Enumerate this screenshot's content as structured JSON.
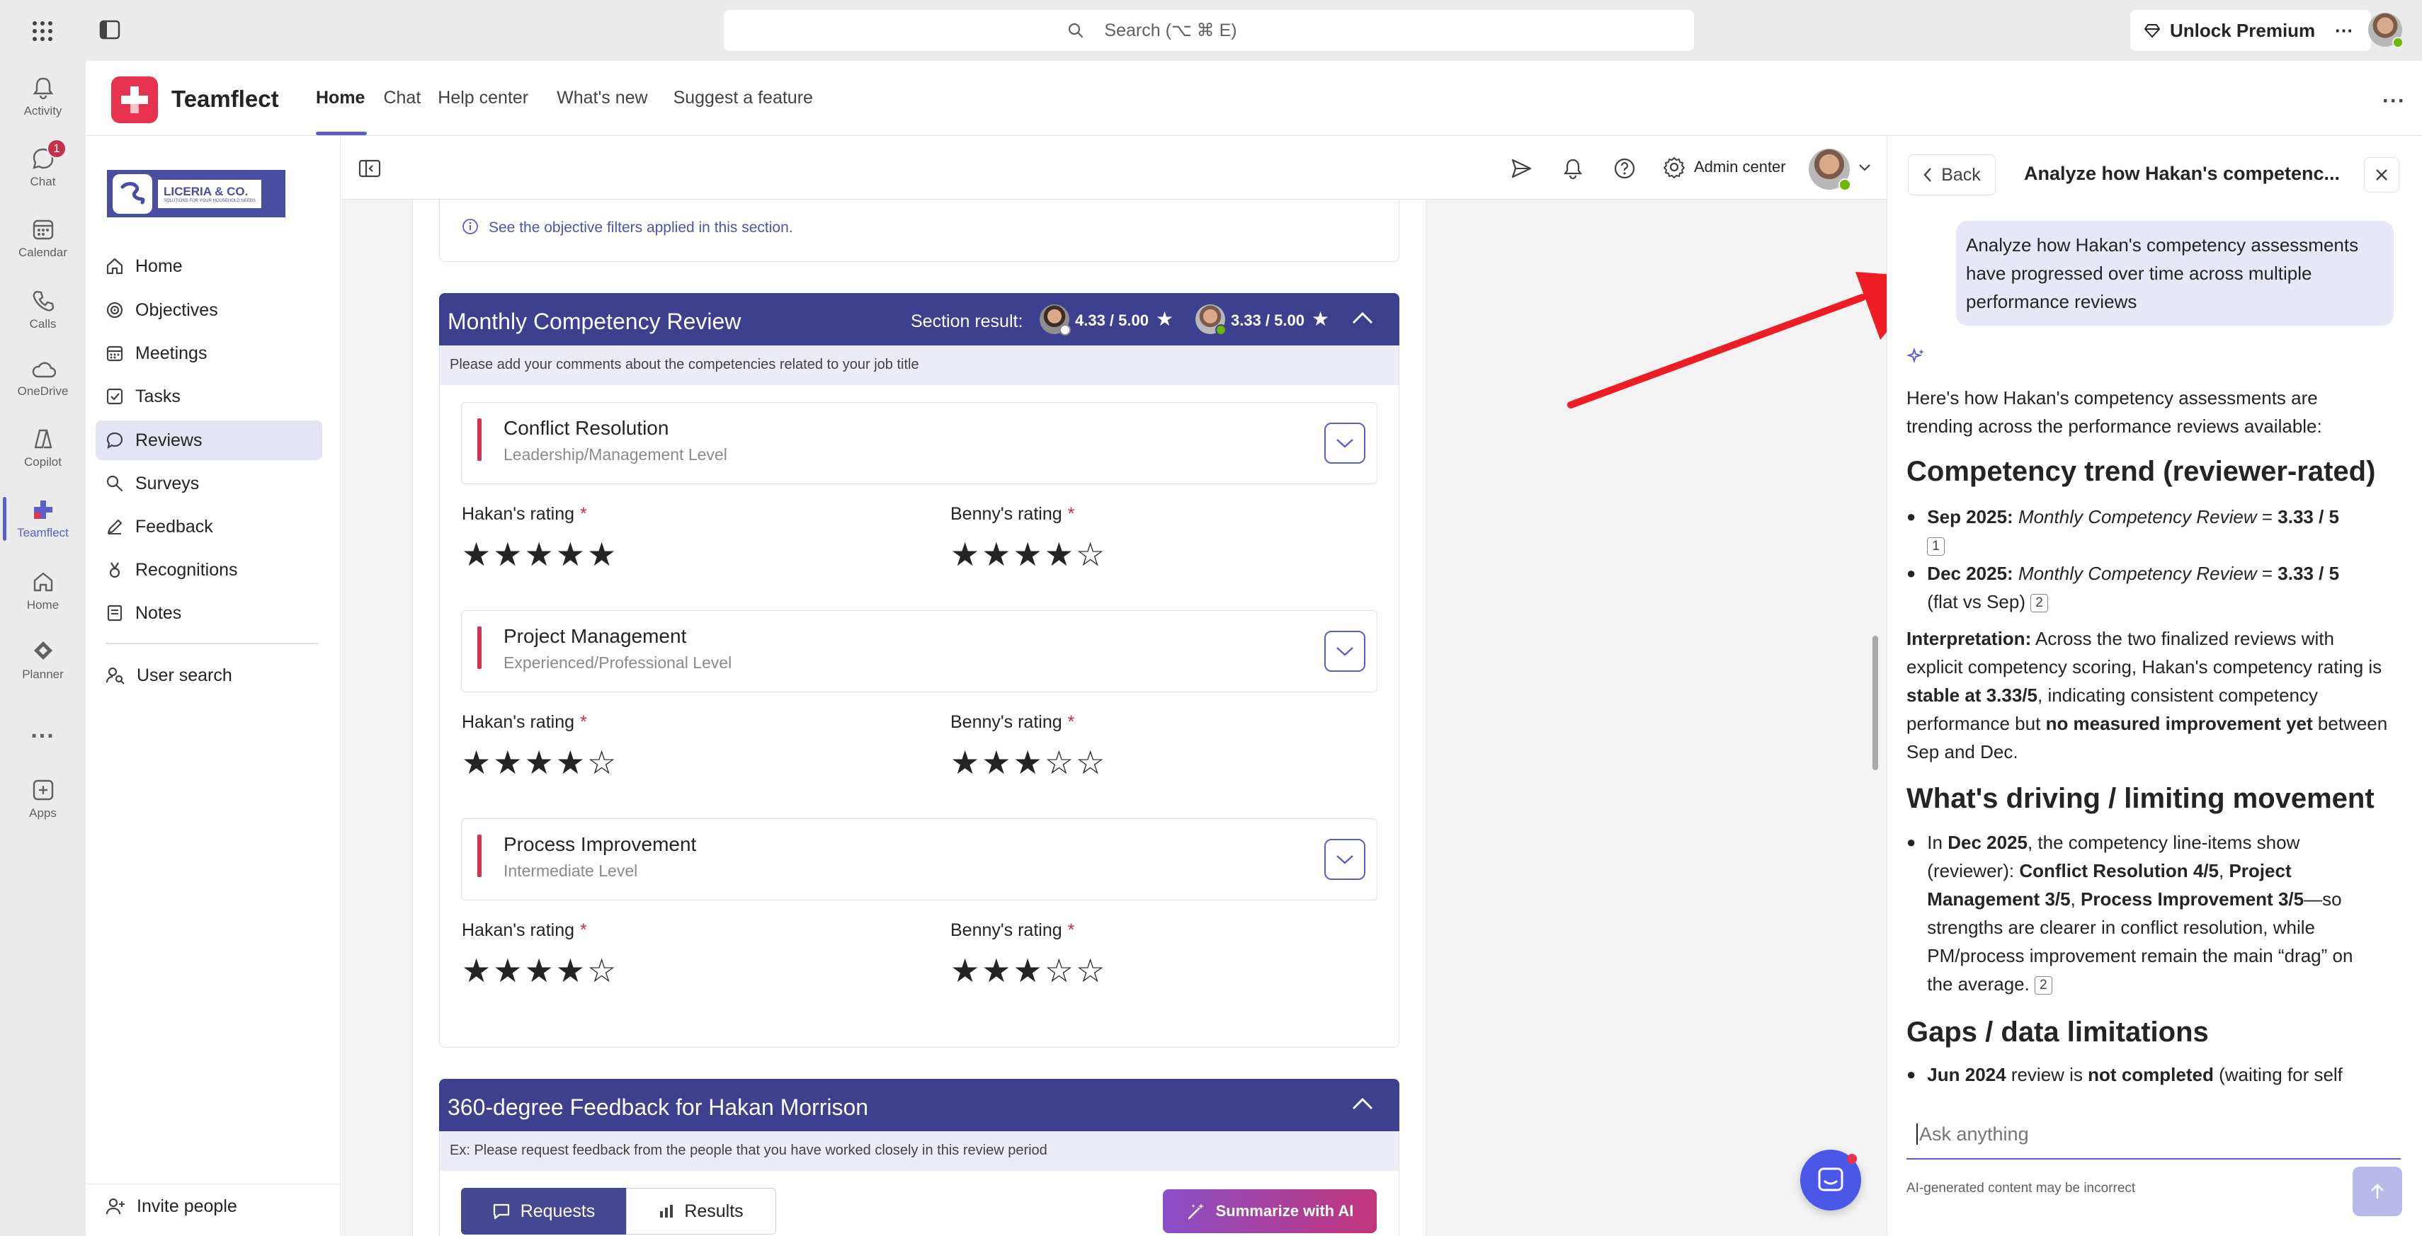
{
  "topbar": {
    "search_placeholder": "Search (⌥ ⌘ E)",
    "unlock_label": "Unlock Premium",
    "more_label": "···"
  },
  "rail": {
    "items": [
      {
        "label": "Activity",
        "icon": "bell-icon"
      },
      {
        "label": "Chat",
        "icon": "chat-icon",
        "badge": "1"
      },
      {
        "label": "Calendar",
        "icon": "calendar-icon"
      },
      {
        "label": "Calls",
        "icon": "phone-icon"
      },
      {
        "label": "OneDrive",
        "icon": "cloud-icon"
      },
      {
        "label": "Copilot",
        "icon": "copilot-icon"
      },
      {
        "label": "Teamflect",
        "icon": "teamflect-icon"
      },
      {
        "label": "Home",
        "icon": "home-icon"
      },
      {
        "label": "Planner",
        "icon": "planner-icon"
      },
      {
        "label": "...",
        "icon": "more-icon"
      },
      {
        "label": "Apps",
        "icon": "apps-icon"
      }
    ]
  },
  "app": {
    "name": "Teamflect",
    "tabs": [
      "Home",
      "Chat",
      "Help center",
      "What's new",
      "Suggest a feature"
    ],
    "active_tab": "Home"
  },
  "logo": {
    "brand": "LICERIA & CO.",
    "tagline": "SOLUTIONS FOR YOUR HOUSEHOLD NEEDS"
  },
  "sidebar": {
    "items": [
      {
        "label": "Home",
        "icon": "home-icon"
      },
      {
        "label": "Objectives",
        "icon": "target-icon"
      },
      {
        "label": "Meetings",
        "icon": "calendar-icon"
      },
      {
        "label": "Tasks",
        "icon": "checkbox-icon"
      },
      {
        "label": "Reviews",
        "icon": "review-icon",
        "active": true
      },
      {
        "label": "Surveys",
        "icon": "survey-icon"
      },
      {
        "label": "Feedback",
        "icon": "feedback-icon"
      },
      {
        "label": "Recognitions",
        "icon": "medal-icon"
      },
      {
        "label": "Notes",
        "icon": "note-icon"
      }
    ],
    "user_search": "User search",
    "invite": "Invite people"
  },
  "mainhead": {
    "admin_center": "Admin center"
  },
  "objective_filter_note": "See the objective filters applied in this section.",
  "section1": {
    "title": "Monthly Competency Review",
    "result_label": "Section result:",
    "self_score": "4.33 / 5.00",
    "reviewer_score": "3.33 / 5.00",
    "subtitle": "Please add your comments about the competencies related to your job title",
    "competencies": [
      {
        "title": "Conflict Resolution",
        "level": "Leadership/Management Level",
        "hakan_label": "Hakan's rating",
        "benny_label": "Benny's rating",
        "hakan": 5,
        "benny": 4
      },
      {
        "title": "Project Management",
        "level": "Experienced/Professional Level",
        "hakan_label": "Hakan's rating",
        "benny_label": "Benny's rating",
        "hakan": 4,
        "benny": 3
      },
      {
        "title": "Process Improvement",
        "level": "Intermediate Level",
        "hakan_label": "Hakan's rating",
        "benny_label": "Benny's rating",
        "hakan": 4,
        "benny": 3
      }
    ],
    "required_mark": "*"
  },
  "section2": {
    "title": "360-degree Feedback for Hakan Morrison",
    "subtitle": "Ex: Please request feedback from the people that you have worked closely in this review period",
    "requests_label": "Requests",
    "results_label": "Results",
    "summarize_label": "Summarize with AI"
  },
  "panel": {
    "back_label": "Back",
    "title": "Analyze how Hakan's competenc...",
    "user_message": "Analyze how Hakan's competency assessments have progressed over time across multiple performance reviews",
    "intro": "Here's how Hakan's competency assessments are trending across the performance reviews available:",
    "h1": "Competency trend (reviewer-rated)",
    "b1_date": "Sep 2025:",
    "b1_review": "Monthly Competency Review",
    "b1_eq": " = ",
    "b1_score": "3.33 / 5",
    "b1_cite": "1",
    "b2_date": "Dec 2025:",
    "b2_review": "Monthly Competency Review",
    "b2_eq": " = ",
    "b2_score": "3.33 / 5",
    "b2_note": "(flat vs Sep)",
    "b2_cite": "2",
    "interp_label": "Interpretation:",
    "interp_1": " Across the two finalized reviews with explicit competency scoring, Hakan's competency rating is ",
    "interp_b1": "stable at 3.33/5",
    "interp_2": ", indicating consistent competency performance but ",
    "interp_b2": "no measured improvement yet",
    "interp_3": " between Sep and Dec.",
    "h2": "What's driving / limiting movement",
    "d_1": "In ",
    "d_b1": "Dec 2025",
    "d_2": ", the competency line-items show (reviewer): ",
    "d_b2": "Conflict Resolution 4/5",
    "d_3": ", ",
    "d_b3": "Project Management 3/5",
    "d_4": ", ",
    "d_b4": "Process Improvement 3/5",
    "d_5": "—so strengths are clearer in conflict resolution, while PM/process improvement remain the main “drag” on the average.",
    "d_cite": "2",
    "h3": "Gaps / data limitations",
    "g_b1": "Jun 2024",
    "g_1": " review is ",
    "g_b2": "not completed",
    "g_2": " (waiting for self",
    "ask_placeholder": "Ask anything",
    "disclaimer": "AI-generated content may be incorrect"
  },
  "colors": {
    "accent": "#5b5fc7",
    "section_header": "#3d3f8f",
    "required": "#c4314b",
    "annotation_arrow": "#ee1c25",
    "teamflect_brand": "#e8334f"
  }
}
